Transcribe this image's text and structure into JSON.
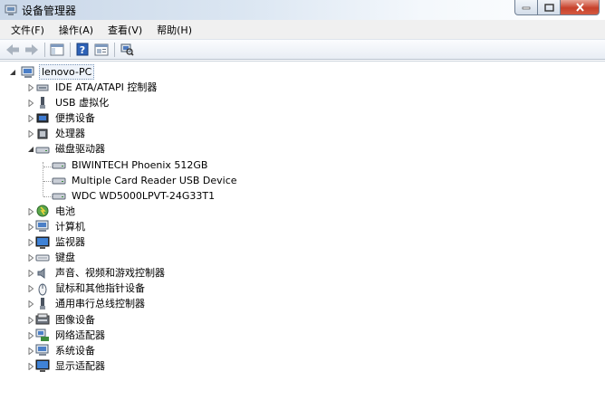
{
  "window": {
    "title": "设备管理器"
  },
  "menu": [
    "文件(F)",
    "操作(A)",
    "查看(V)",
    "帮助(H)"
  ],
  "toolbar": {
    "buttons": [
      "back-arrow-icon",
      "forward-arrow-icon",
      "show-hide-console-tree-icon",
      "help-icon",
      "properties-icon",
      "scan-hardware-icon"
    ]
  },
  "tree": {
    "root": "lenovo-PC",
    "categories": [
      {
        "label": "IDE ATA/ATAPI 控制器",
        "icon": "ide-controller-icon",
        "expanded": false
      },
      {
        "label": "USB 虚拟化",
        "icon": "usb-icon",
        "expanded": false
      },
      {
        "label": "便携设备",
        "icon": "portable-device-icon",
        "expanded": false
      },
      {
        "label": "处理器",
        "icon": "processor-icon",
        "expanded": false
      },
      {
        "label": "磁盘驱动器",
        "icon": "disk-drive-icon",
        "expanded": true
      },
      {
        "label": "电池",
        "icon": "battery-icon",
        "expanded": false
      },
      {
        "label": "计算机",
        "icon": "computer-icon",
        "expanded": false
      },
      {
        "label": "监视器",
        "icon": "monitor-icon",
        "expanded": false
      },
      {
        "label": "键盘",
        "icon": "keyboard-icon",
        "expanded": false
      },
      {
        "label": "声音、视频和游戏控制器",
        "icon": "sound-icon",
        "expanded": false
      },
      {
        "label": "鼠标和其他指针设备",
        "icon": "mouse-icon",
        "expanded": false
      },
      {
        "label": "通用串行总线控制器",
        "icon": "usb-controller-icon",
        "expanded": false
      },
      {
        "label": "图像设备",
        "icon": "imaging-device-icon",
        "expanded": false
      },
      {
        "label": "网络适配器",
        "icon": "network-adapter-icon",
        "expanded": false
      },
      {
        "label": "系统设备",
        "icon": "system-device-icon",
        "expanded": false
      },
      {
        "label": "显示适配器",
        "icon": "display-adapter-icon",
        "expanded": false
      }
    ],
    "disk_children": [
      "BIWINTECH Phoenix 512GB",
      "Multiple Card  Reader USB Device",
      "WDC WD5000LPVT-24G33T1"
    ]
  }
}
